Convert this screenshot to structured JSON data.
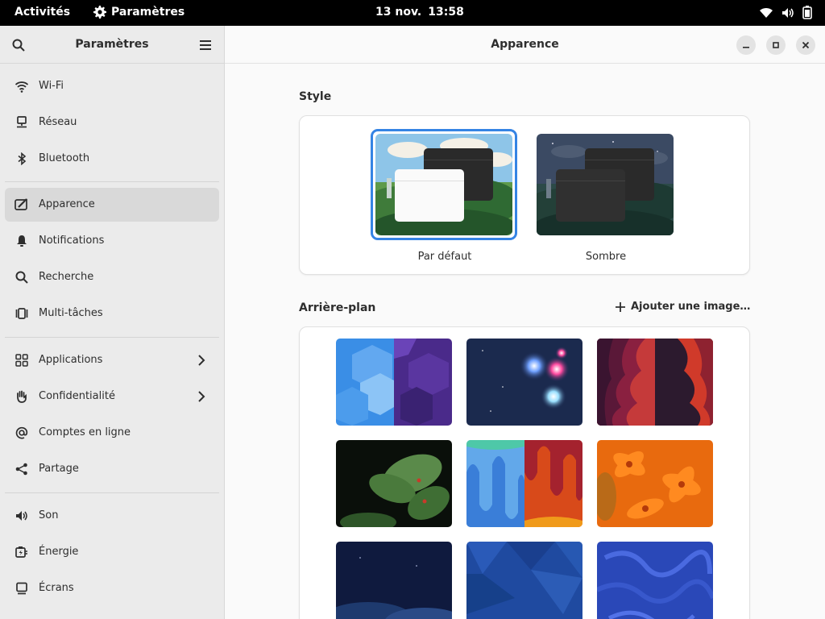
{
  "topbar": {
    "activities": "Activités",
    "app_name": "Paramètres",
    "date": "13 nov.",
    "time": "13:58",
    "tray_icons": [
      "wifi-icon",
      "volume-icon",
      "battery-icon"
    ]
  },
  "sidebar": {
    "title": "Paramètres",
    "items": [
      {
        "label": "Wi-Fi",
        "icon": "wifi-icon"
      },
      {
        "label": "Réseau",
        "icon": "network-icon"
      },
      {
        "label": "Bluetooth",
        "icon": "bluetooth-icon"
      },
      {
        "label": "Apparence",
        "icon": "appearance-icon",
        "active": true
      },
      {
        "label": "Notifications",
        "icon": "bell-icon"
      },
      {
        "label": "Recherche",
        "icon": "search-icon"
      },
      {
        "label": "Multi-tâches",
        "icon": "multitasking-icon"
      },
      {
        "label": "Applications",
        "icon": "apps-grid-icon",
        "has_submenu": true
      },
      {
        "label": "Confidentialité",
        "icon": "hand-icon",
        "has_submenu": true
      },
      {
        "label": "Comptes en ligne",
        "icon": "at-icon"
      },
      {
        "label": "Partage",
        "icon": "share-icon"
      },
      {
        "label": "Son",
        "icon": "speaker-icon"
      },
      {
        "label": "Énergie",
        "icon": "power-icon"
      },
      {
        "label": "Écrans",
        "icon": "display-icon"
      }
    ]
  },
  "content": {
    "title": "Apparence",
    "style_section": {
      "title": "Style",
      "options": [
        {
          "label": "Par défaut",
          "selected": true
        },
        {
          "label": "Sombre",
          "selected": false
        }
      ]
    },
    "background_section": {
      "title": "Arrière-plan",
      "add_button": "Ajouter une image…"
    }
  },
  "colors": {
    "accent": "#3584e4",
    "sidebar_bg": "#ebebeb",
    "content_bg": "#fafafa"
  }
}
